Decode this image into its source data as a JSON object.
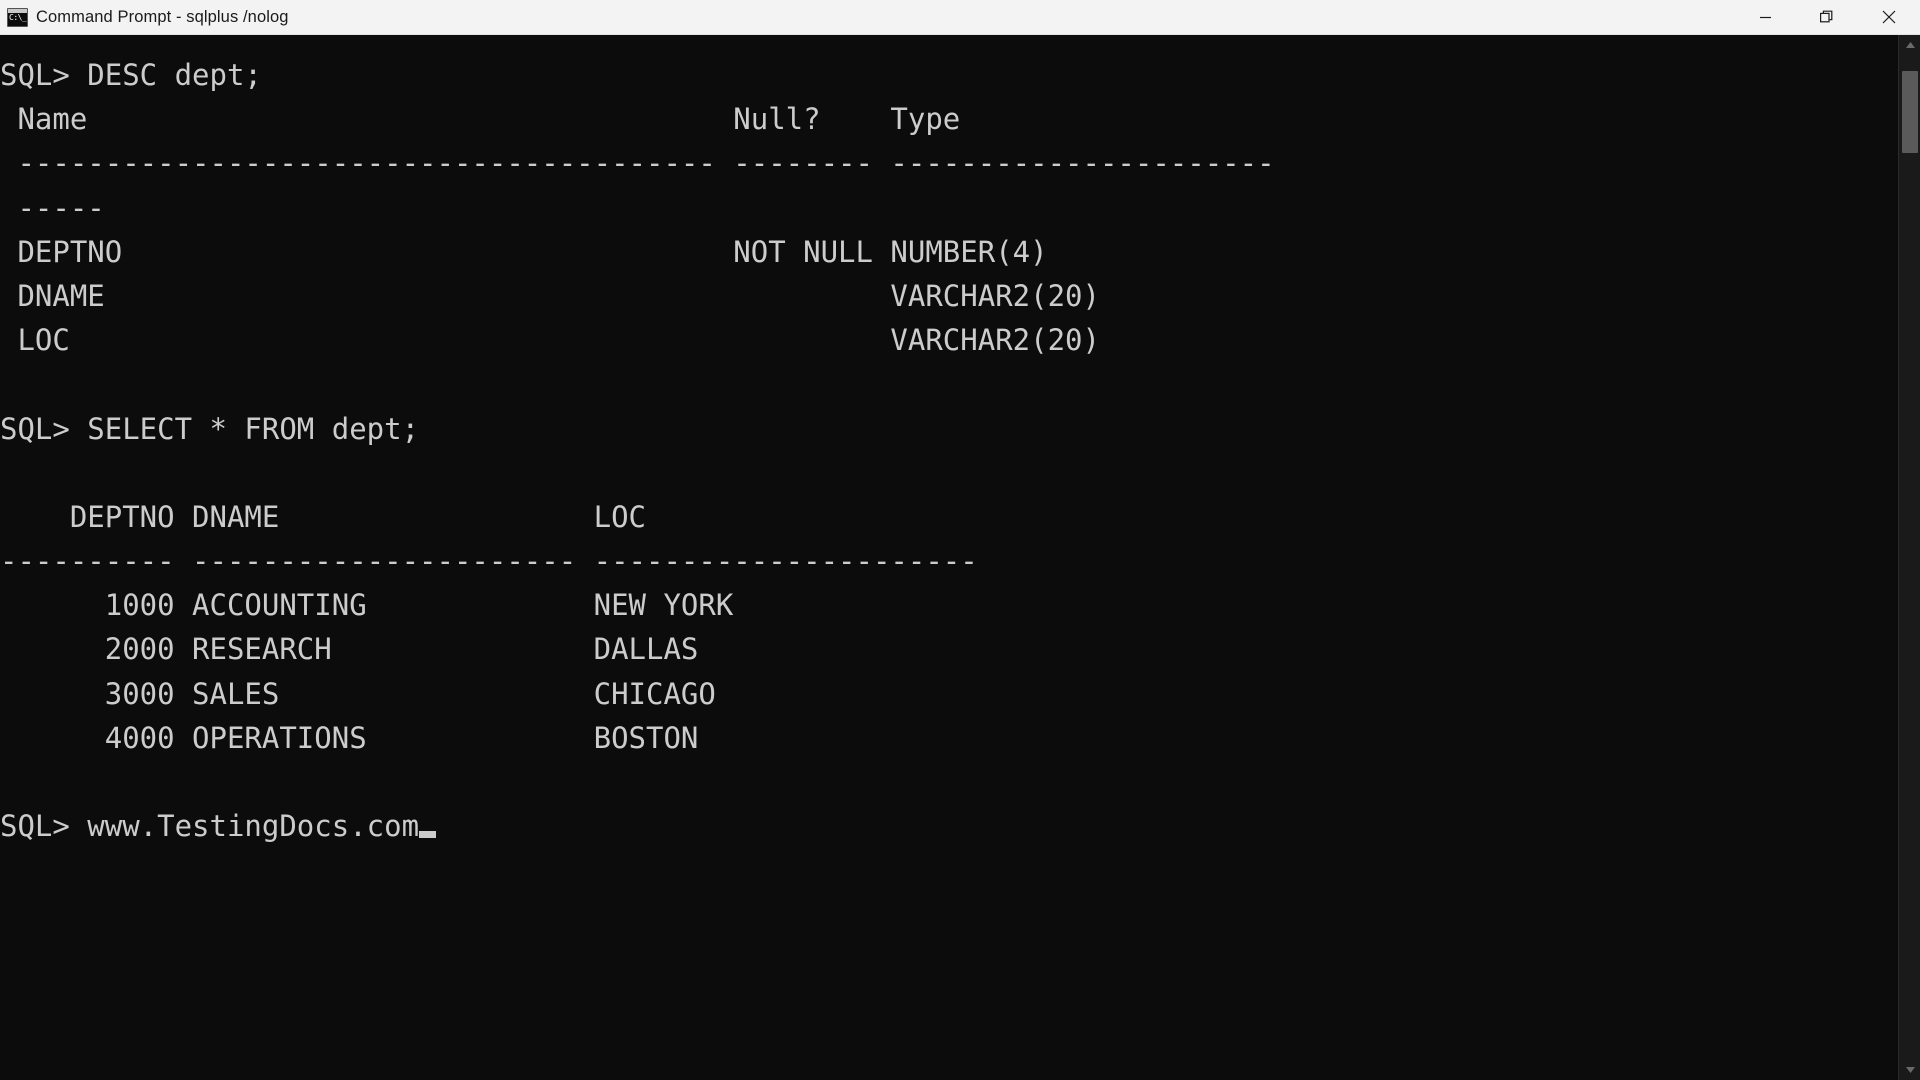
{
  "window": {
    "title": "Command Prompt - sqlplus  /nolog",
    "icon": "cmd-icon",
    "controls": {
      "minimize": "minimize-button",
      "restore": "restore-button",
      "close": "close-button"
    },
    "colors": {
      "titlebar_bg": "#f3f3f3",
      "titlebar_text": "#1b1b1b",
      "terminal_bg": "#0c0c0c",
      "terminal_text": "#cccccc",
      "scrollbar_thumb": "#5a5a5a"
    }
  },
  "terminal": {
    "prompt": "SQL>",
    "cursor": "block",
    "lines": [
      {
        "id": "cmd-desc",
        "text": "SQL> DESC dept;"
      },
      {
        "id": "desc-header",
        "text": " Name                                     Null?    Type"
      },
      {
        "id": "desc-rule-1",
        "text": " ---------------------------------------- -------- ----------------------"
      },
      {
        "id": "desc-rule-2",
        "text": " -----"
      },
      {
        "id": "desc-row-deptno",
        "text": " DEPTNO                                   NOT NULL NUMBER(4)"
      },
      {
        "id": "desc-row-dname",
        "text": " DNAME                                             VARCHAR2(20)"
      },
      {
        "id": "desc-row-loc",
        "text": " LOC                                               VARCHAR2(20)"
      },
      {
        "id": "blank-1",
        "text": " "
      },
      {
        "id": "cmd-select",
        "text": "SQL> SELECT * FROM dept;"
      },
      {
        "id": "blank-2",
        "text": " "
      },
      {
        "id": "select-header",
        "text": "    DEPTNO DNAME                  LOC"
      },
      {
        "id": "select-rule",
        "text": "---------- ---------------------- ----------------------"
      },
      {
        "id": "select-row-1",
        "text": "      1000 ACCOUNTING             NEW YORK"
      },
      {
        "id": "select-row-2",
        "text": "      2000 RESEARCH               DALLAS"
      },
      {
        "id": "select-row-3",
        "text": "      3000 SALES                  CHICAGO"
      },
      {
        "id": "select-row-4",
        "text": "      4000 OPERATIONS             BOSTON"
      },
      {
        "id": "blank-3",
        "text": " "
      },
      {
        "id": "prompt-final",
        "text": "SQL> www.TestingDocs.com"
      }
    ]
  },
  "desc_table": {
    "command": "DESC dept;",
    "columns": [
      "Name",
      "Null?",
      "Type"
    ],
    "rows": [
      {
        "name": "DEPTNO",
        "null": "NOT NULL",
        "type": "NUMBER(4)"
      },
      {
        "name": "DNAME",
        "null": "",
        "type": "VARCHAR2(20)"
      },
      {
        "name": "LOC",
        "null": "",
        "type": "VARCHAR2(20)"
      }
    ]
  },
  "select_table": {
    "command": "SELECT * FROM dept;",
    "columns": [
      "DEPTNO",
      "DNAME",
      "LOC"
    ],
    "rows": [
      {
        "deptno": "1000",
        "dname": "ACCOUNTING",
        "loc": "NEW YORK"
      },
      {
        "deptno": "2000",
        "dname": "RESEARCH",
        "loc": "DALLAS"
      },
      {
        "deptno": "3000",
        "dname": "SALES",
        "loc": "CHICAGO"
      },
      {
        "deptno": "4000",
        "dname": "OPERATIONS",
        "loc": "BOSTON"
      }
    ]
  },
  "scrollbar": {
    "orientation": "vertical",
    "position": "top"
  }
}
